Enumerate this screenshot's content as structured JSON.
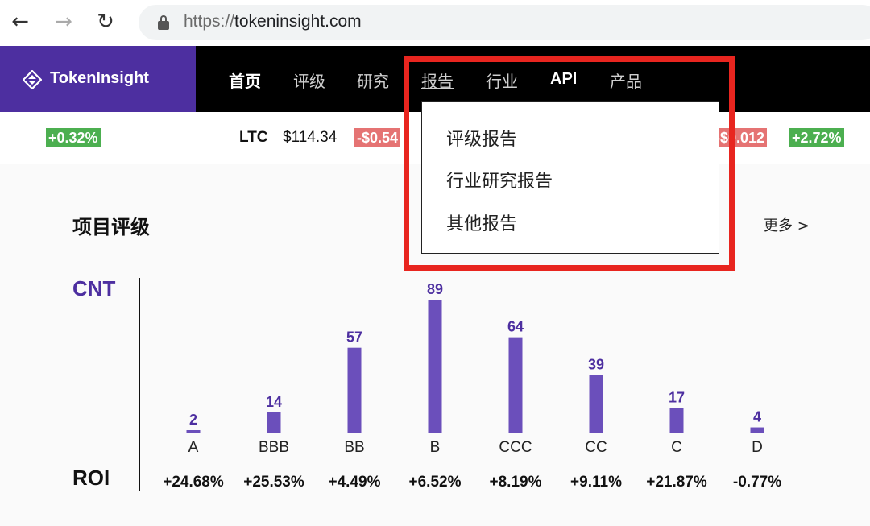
{
  "browser": {
    "url_scheme": "https://",
    "url_host": "tokeninsight.com"
  },
  "site": {
    "logo_text": "TokenInsight",
    "nav": [
      "首页",
      "评级",
      "研究",
      "报告",
      "行业",
      "API",
      "产品"
    ]
  },
  "ticker": {
    "left_change": "+0.32%",
    "ltc_symbol": "LTC",
    "ltc_price": "$114.34",
    "ltc_change": "-$0.54",
    "right_change_value": "-$0.012",
    "right_change_pct": "+2.72%"
  },
  "dropdown": {
    "items": [
      "评级报告",
      "行业研究报告",
      "其他报告"
    ]
  },
  "section": {
    "title": "项目评级",
    "more": "更多 >"
  },
  "chart_data": {
    "type": "bar",
    "categories": [
      "A",
      "BBB",
      "BB",
      "B",
      "CCC",
      "CC",
      "C",
      "D"
    ],
    "values": [
      2,
      14,
      57,
      89,
      64,
      39,
      17,
      4
    ],
    "ylabel": "CNT",
    "roi_label": "ROI",
    "roi": [
      "+24.68%",
      "+25.53%",
      "+4.49%",
      "+6.52%",
      "+8.19%",
      "+9.11%",
      "+21.87%",
      "-0.77%"
    ],
    "bar_color": "#6b4fbb",
    "label_color": "#4d2fa0"
  },
  "colors": {
    "brand": "#4d2fa0",
    "highlight": "#e8251f",
    "positive": "#4caf50",
    "negative": "#e57373"
  }
}
